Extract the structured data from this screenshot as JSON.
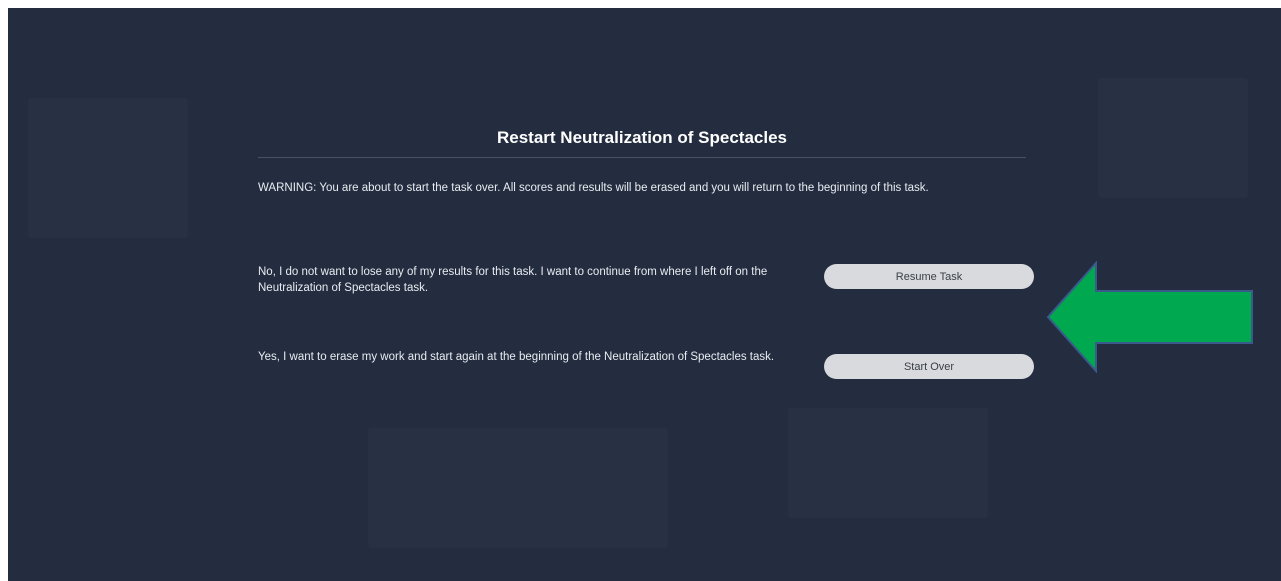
{
  "dialog": {
    "title": "Restart Neutralization of Spectacles",
    "warning": "WARNING: You are about to start the task over. All scores and results will be erased and you will return to the beginning of this task.",
    "resume_text": "No, I do not want to lose any of my results for this task. I want to continue from where I left off on the Neutralization of Spectacles task.",
    "resume_label": "Resume Task",
    "start_text": "Yes, I want to erase my work and start again at the beginning of the Neutralization of Spectacles task.",
    "start_label": "Start Over"
  },
  "colors": {
    "background": "#232d3f",
    "button": "#d8dadd",
    "arrow": "#00a94f",
    "arrow_outline": "#3a5a8c"
  },
  "icons": {
    "pointer": "arrow-left-icon"
  }
}
